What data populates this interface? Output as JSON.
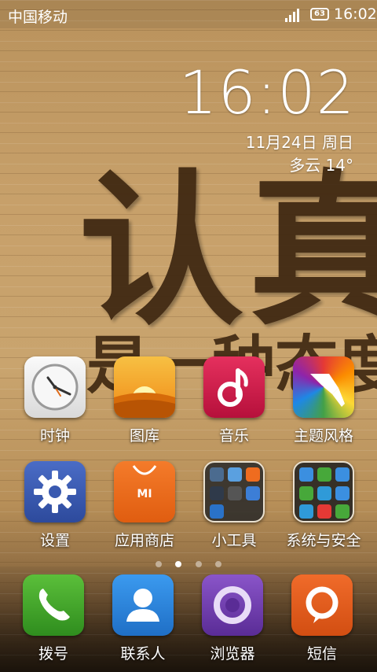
{
  "status_bar": {
    "carrier": "中国移动",
    "battery": "63",
    "time": "16:02"
  },
  "clock_widget": {
    "time": "16:02",
    "date": "11月24日 周日",
    "weather": "多云  14°"
  },
  "wallpaper": {
    "text_line1": "认真",
    "text_line2": "是一种态度"
  },
  "grid_apps": [
    {
      "label": "时钟",
      "icon": "clock-icon",
      "color": "#f0f0f0"
    },
    {
      "label": "图库",
      "icon": "gallery-icon",
      "color": "#f39a1b"
    },
    {
      "label": "音乐",
      "icon": "music-icon",
      "color": "#d4194a"
    },
    {
      "label": "主题风格",
      "icon": "theme-brush-icon",
      "color": "#9b59b6"
    },
    {
      "label": "设置",
      "icon": "settings-gear-icon",
      "color": "#3a5ab0"
    },
    {
      "label": "应用商店",
      "icon": "app-store-icon",
      "color": "#ef6c1f"
    },
    {
      "label": "小工具",
      "icon": "folder-icon",
      "color": "#3b3b3b"
    },
    {
      "label": "系统与安全",
      "icon": "folder-icon",
      "color": "#2b2b2b"
    }
  ],
  "page_indicator": {
    "pages": 4,
    "active_index": 1
  },
  "dock_apps": [
    {
      "label": "拨号",
      "icon": "phone-icon",
      "color": "#3fa328"
    },
    {
      "label": "联系人",
      "icon": "contacts-icon",
      "color": "#2b82d6"
    },
    {
      "label": "浏览器",
      "icon": "browser-icon",
      "color": "#6f3ca8"
    },
    {
      "label": "短信",
      "icon": "messages-icon",
      "color": "#e25a1d"
    }
  ]
}
